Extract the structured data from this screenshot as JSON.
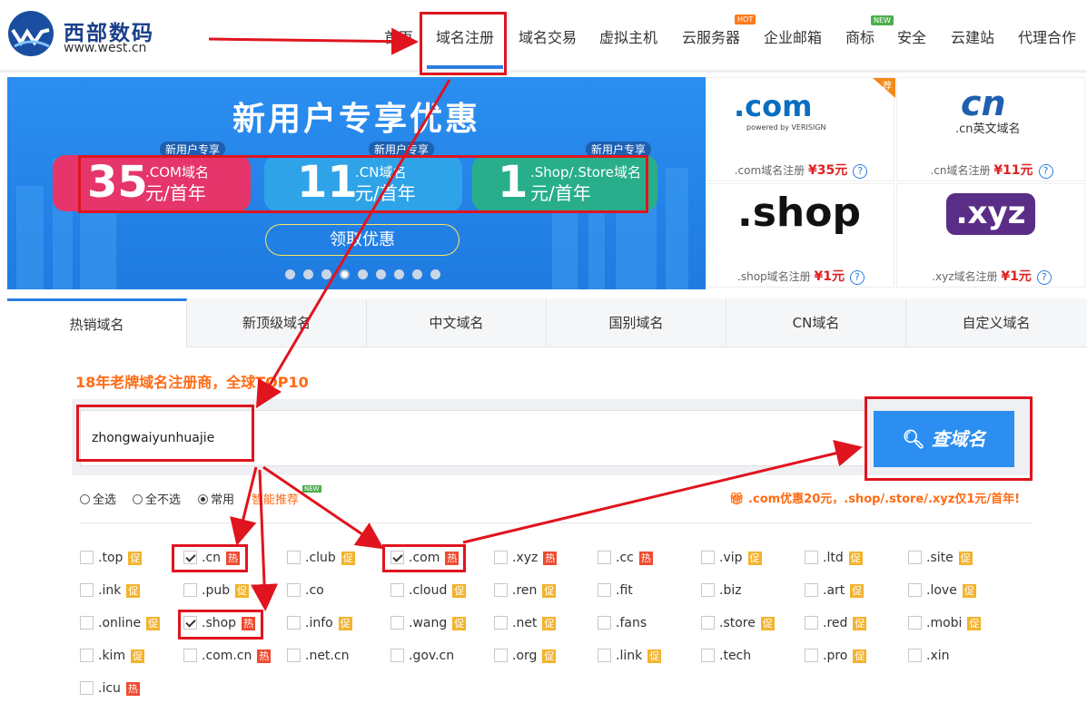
{
  "brand": {
    "title": "西部数码",
    "url": "www.west.cn"
  },
  "nav": [
    {
      "label": "首页"
    },
    {
      "label": "域名注册"
    },
    {
      "label": "域名交易"
    },
    {
      "label": "虚拟主机"
    },
    {
      "label": "云服务器",
      "badge": "HOT"
    },
    {
      "label": "企业邮箱"
    },
    {
      "label": "商标",
      "badge": "NEW"
    },
    {
      "label": "安全"
    },
    {
      "label": "云建站"
    },
    {
      "label": "代理合作"
    }
  ],
  "banner": {
    "title": "新用户专享优惠",
    "coupons": [
      {
        "tag": "新用户专享",
        "num": "35",
        "line1": ".COM域名",
        "line2": "元/首年"
      },
      {
        "tag": "新用户专享",
        "num": "11",
        "line1": ".CN域名",
        "line2": "元/首年"
      },
      {
        "tag": "新用户专享",
        "num": "1",
        "line1": ".Shop/.Store域名",
        "line2": "元/首年"
      }
    ],
    "button": "领取优惠",
    "dots": 9,
    "active_dot": 4
  },
  "tiles": [
    {
      "logo": ".com",
      "sub": "powered by VERISIGN",
      "label": ".com域名注册",
      "price": "¥35元",
      "corner": "荐"
    },
    {
      "logo": "cn",
      "sub": ".cn英文域名",
      "label": ".cn域名注册",
      "price": "¥11元"
    },
    {
      "logo": ".shop",
      "label": ".shop域名注册",
      "price": "¥1元"
    },
    {
      "logo": ".xyz",
      "label": ".xyz域名注册",
      "price": "¥1元"
    }
  ],
  "tabs": [
    "热销域名",
    "新顶级域名",
    "中文域名",
    "国别域名",
    "CN域名",
    "自定义域名"
  ],
  "slogan": "18年老牌域名注册商，全球TOP10",
  "search": {
    "value": "zhongwaiyunhuajie",
    "button": "查域名"
  },
  "options": {
    "all": "全选",
    "none": "全不选",
    "common": "常用",
    "smart": "智能推荐",
    "smart_badge": "NEW"
  },
  "promo": ".com优惠20元，.shop/.store/.xyz仅1元/首年!",
  "hot_label": "热",
  "promo_label": "促",
  "extensions": [
    [
      {
        "n": ".top",
        "t": "promo"
      },
      {
        "n": ".cn",
        "t": "hot",
        "c": true
      },
      {
        "n": ".club",
        "t": "promo"
      },
      {
        "n": ".com",
        "t": "hot",
        "c": true
      },
      {
        "n": ".xyz",
        "t": "hot"
      },
      {
        "n": ".cc",
        "t": "hot"
      },
      {
        "n": ".vip",
        "t": "promo"
      },
      {
        "n": ".ltd",
        "t": "promo"
      },
      {
        "n": ".site",
        "t": "promo"
      }
    ],
    [
      {
        "n": ".ink",
        "t": "promo"
      },
      {
        "n": ".pub",
        "t": "promo"
      },
      {
        "n": ".co"
      },
      {
        "n": ".cloud",
        "t": "promo"
      },
      {
        "n": ".ren",
        "t": "promo"
      },
      {
        "n": ".fit"
      },
      {
        "n": ".biz"
      },
      {
        "n": ".art",
        "t": "promo"
      },
      {
        "n": ".love",
        "t": "promo"
      }
    ],
    [
      {
        "n": ".online",
        "t": "promo"
      },
      {
        "n": ".shop",
        "t": "hot",
        "c": true
      },
      {
        "n": ".info",
        "t": "promo"
      },
      {
        "n": ".wang",
        "t": "promo"
      },
      {
        "n": ".net",
        "t": "promo"
      },
      {
        "n": ".fans"
      },
      {
        "n": ".store",
        "t": "promo"
      },
      {
        "n": ".red",
        "t": "promo"
      },
      {
        "n": ".mobi",
        "t": "promo"
      }
    ],
    [
      {
        "n": ".kim",
        "t": "promo"
      },
      {
        "n": ".com.cn",
        "t": "hot"
      },
      {
        "n": ".net.cn"
      },
      {
        "n": ".gov.cn"
      },
      {
        "n": ".org",
        "t": "promo"
      },
      {
        "n": ".link",
        "t": "promo"
      },
      {
        "n": ".tech"
      },
      {
        "n": ".pro",
        "t": "promo"
      },
      {
        "n": ".xin"
      }
    ],
    [
      {
        "n": ".icu",
        "t": "hot"
      }
    ]
  ]
}
